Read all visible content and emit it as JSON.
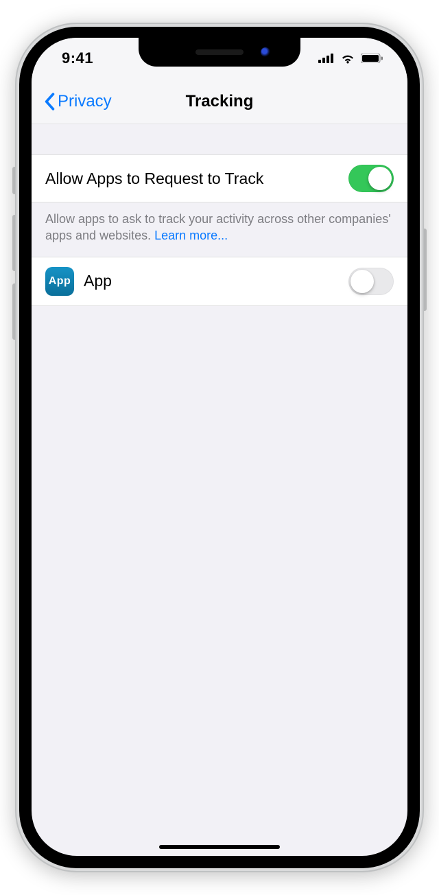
{
  "statusbar": {
    "time": "9:41"
  },
  "nav": {
    "back_label": "Privacy",
    "title": "Tracking"
  },
  "cells": {
    "allow": {
      "label": "Allow Apps to Request to Track",
      "on": true
    },
    "footer_text": "Allow apps to ask to track your activity across other companies' apps and websites. ",
    "learn_more": "Learn more...",
    "app": {
      "icon_text": "App",
      "label": "App",
      "on": false
    }
  },
  "colors": {
    "accent": "#0a7aff",
    "toggle_on": "#34c759"
  }
}
